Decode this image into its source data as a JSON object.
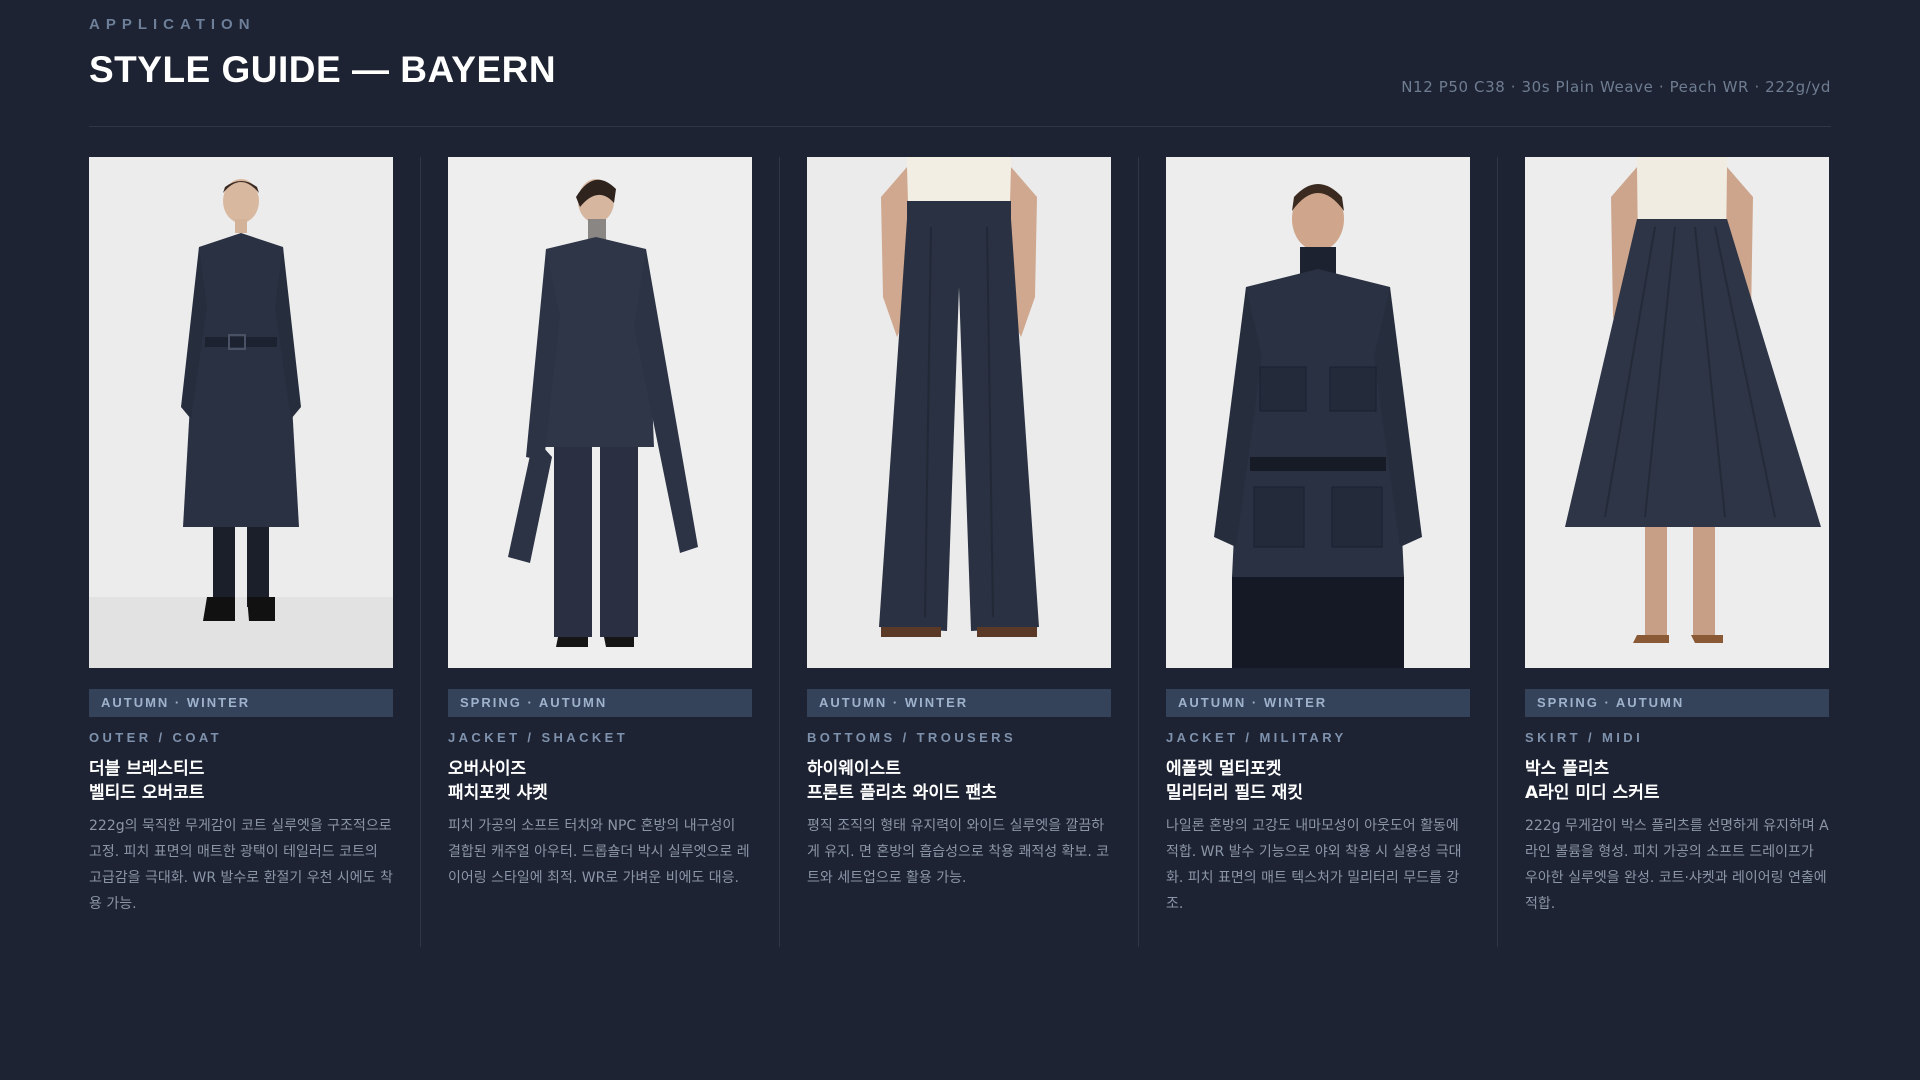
{
  "header": {
    "eyebrow": "APPLICATION",
    "title": "STYLE GUIDE — BAYERN",
    "spec": "N12 P50 C38 · 30s Plain Weave · Peach WR · 222g/yd"
  },
  "colors": {
    "background": "#1d2332",
    "season_tag": "#34435a",
    "garment_navy": "#2a3142"
  },
  "cards": [
    {
      "image": "model-double-breasted-belted-overcoat",
      "season": "AUTUMN · WINTER",
      "category": "OUTER / COAT",
      "name_line1": "더블 브레스티드",
      "name_line2": "벨티드 오버코트",
      "desc": "222g의 묵직한 무게감이 코트 실루엣을 구조적으로 고정. 피치 표면의 매트한 광택이 테일러드 코트의 고급감을 극대화. WR 발수로 환절기 우천 시에도 착용 가능."
    },
    {
      "image": "model-oversized-patch-pocket-shacket",
      "season": "SPRING · AUTUMN",
      "category": "JACKET / SHACKET",
      "name_line1": "오버사이즈",
      "name_line2": "패치포켓 샤켓",
      "desc": "피치 가공의 소프트 터치와 NPC 혼방의 내구성이 결합된 캐주얼 아우터. 드롭숄더 박시 실루엣으로 레이어링 스타일에 최적. WR로 가벼운 비에도 대응."
    },
    {
      "image": "model-high-waist-pleated-wide-trousers",
      "season": "AUTUMN · WINTER",
      "category": "BOTTOMS / TROUSERS",
      "name_line1": "하이웨이스트",
      "name_line2": "프론트 플리츠 와이드 팬츠",
      "desc": "평직 조직의 형태 유지력이 와이드 실루엣을 깔끔하게 유지. 면 혼방의 흡습성으로 착용 쾌적성 확보. 코트와 세트업으로 활용 가능."
    },
    {
      "image": "model-epaulette-multi-pocket-field-jacket",
      "season": "AUTUMN · WINTER",
      "category": "JACKET / MILITARY",
      "name_line1": "에폴렛 멀티포켓",
      "name_line2": "밀리터리 필드 재킷",
      "desc": "나일론 혼방의 고강도 내마모성이 아웃도어 활동에 적합. WR 발수 기능으로 야외 착용 시 실용성 극대화. 피치 표면의 매트 텍스처가 밀리터리 무드를 강조."
    },
    {
      "image": "model-box-pleats-a-line-midi-skirt",
      "season": "SPRING · AUTUMN",
      "category": "SKIRT / MIDI",
      "name_line1": "박스 플리츠",
      "name_line2": "A라인 미디 스커트",
      "desc": "222g 무게감이 박스 플리츠를 선명하게 유지하며 A라인 볼륨을 형성. 피치 가공의 소프트 드레이프가 우아한 실루엣을 완성. 코트·샤켓과 레이어링 연출에 적합."
    }
  ]
}
